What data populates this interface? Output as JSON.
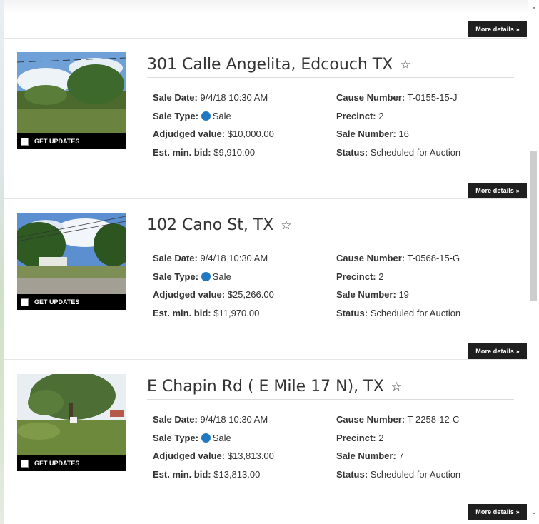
{
  "more_details_label": "More details »",
  "get_updates_label": "GET UPDATES",
  "labels": {
    "sale_date": "Sale Date:",
    "sale_type": "Sale Type:",
    "adjudged_value": "Adjudged value:",
    "min_bid": "Est. min. bid:",
    "cause_number": "Cause Number:",
    "precinct": "Precinct:",
    "sale_number": "Sale Number:",
    "status": "Status:"
  },
  "listings": [
    {
      "title": "301 Calle Angelita, Edcouch TX",
      "sale_date": "9/4/18 10:30 AM",
      "sale_type": "Sale",
      "adjudged_value": "$10,000.00",
      "min_bid": "$9,910.00",
      "cause_number": "T-0155-15-J",
      "precinct": "2",
      "sale_number": "16",
      "status": "Scheduled for Auction"
    },
    {
      "title": "102 Cano St, TX",
      "sale_date": "9/4/18 10:30 AM",
      "sale_type": "Sale",
      "adjudged_value": "$25,266.00",
      "min_bid": "$11,970.00",
      "cause_number": "T-0568-15-G",
      "precinct": "2",
      "sale_number": "19",
      "status": "Scheduled for Auction"
    },
    {
      "title": "E Chapin Rd ( E Mile 17 N), TX",
      "sale_date": "9/4/18 10:30 AM",
      "sale_type": "Sale",
      "adjudged_value": "$13,813.00",
      "min_bid": "$13,813.00",
      "cause_number": "T-2258-12-C",
      "precinct": "2",
      "sale_number": "7",
      "status": "Scheduled for Auction"
    }
  ],
  "icons": {
    "star": "star-outline-icon",
    "sale_type_dot": "blue-dot-icon",
    "sale_type_dot_color": "#1f78c1"
  }
}
